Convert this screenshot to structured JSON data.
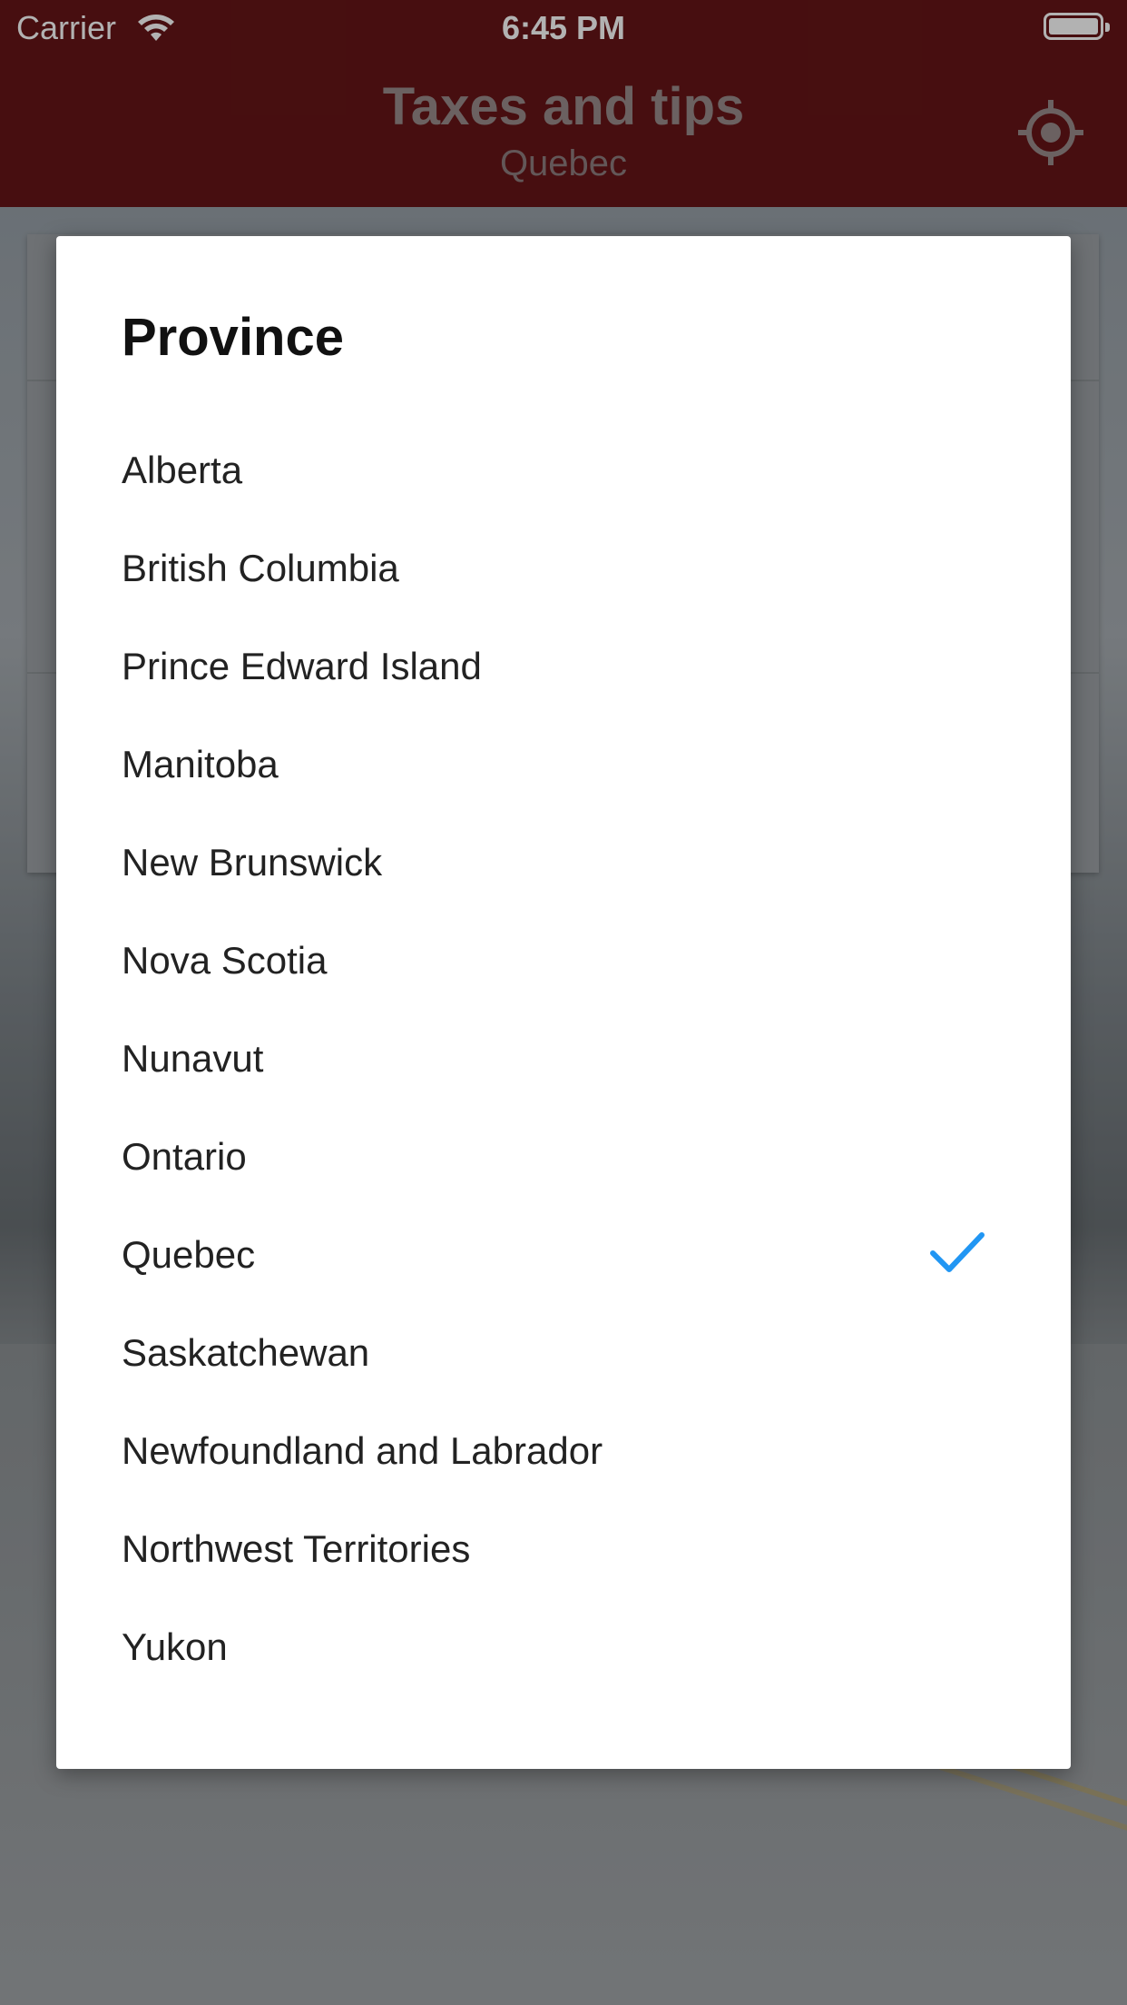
{
  "status_bar": {
    "carrier": "Carrier",
    "time": "6:45 PM"
  },
  "nav": {
    "title": "Taxes and tips",
    "subtitle": "Quebec",
    "locate_icon": "crosshair-location-icon"
  },
  "dialog": {
    "title": "Province",
    "selected": "Quebec",
    "check_color": "#2196F3",
    "options": [
      "Alberta",
      "British Columbia",
      "Prince Edward Island",
      "Manitoba",
      "New Brunswick",
      "Nova Scotia",
      "Nunavut",
      "Ontario",
      "Quebec",
      "Saskatchewan",
      "Newfoundland and Labrador",
      "Northwest Territories",
      "Yukon"
    ]
  },
  "colors": {
    "nav_background": "#661517",
    "accent": "#2196F3"
  }
}
